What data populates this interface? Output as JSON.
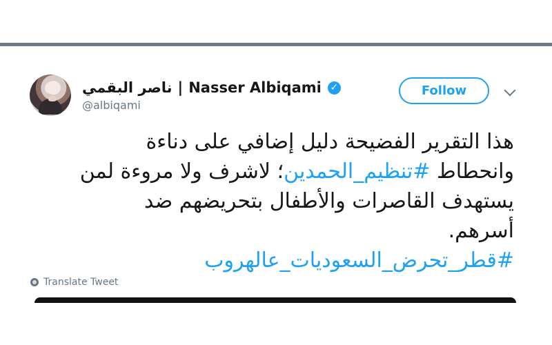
{
  "tweet": {
    "display_name_ar": "ناصر البقمي",
    "separator": "|",
    "display_name_en": "Nasser Albiqami",
    "verified_symbol": "✓",
    "handle": "@albiqami",
    "follow_label": "Follow",
    "text_lines": [
      "هذا التقرير الفضيحة دليل إضافي على دناءة",
      "وانحطاط ",
      "#تنظيم_الحمدين",
      "؛ لاشرف ولا مروءة لمن",
      "يستهدف القاصرات والأطفال بتحريضهم ضد",
      "أسرهم.",
      "#قطر_تحرض_السعوديات_عالهروب"
    ],
    "translate_label": "Translate Tweet",
    "link_color": "#1da1f2",
    "text_color": "#14171a",
    "muted_color": "#657786"
  },
  "icons": {
    "avatar": "profile-photo",
    "verified": "verified-badge-icon",
    "more": "chevron-down-icon",
    "translate": "globe-icon"
  }
}
